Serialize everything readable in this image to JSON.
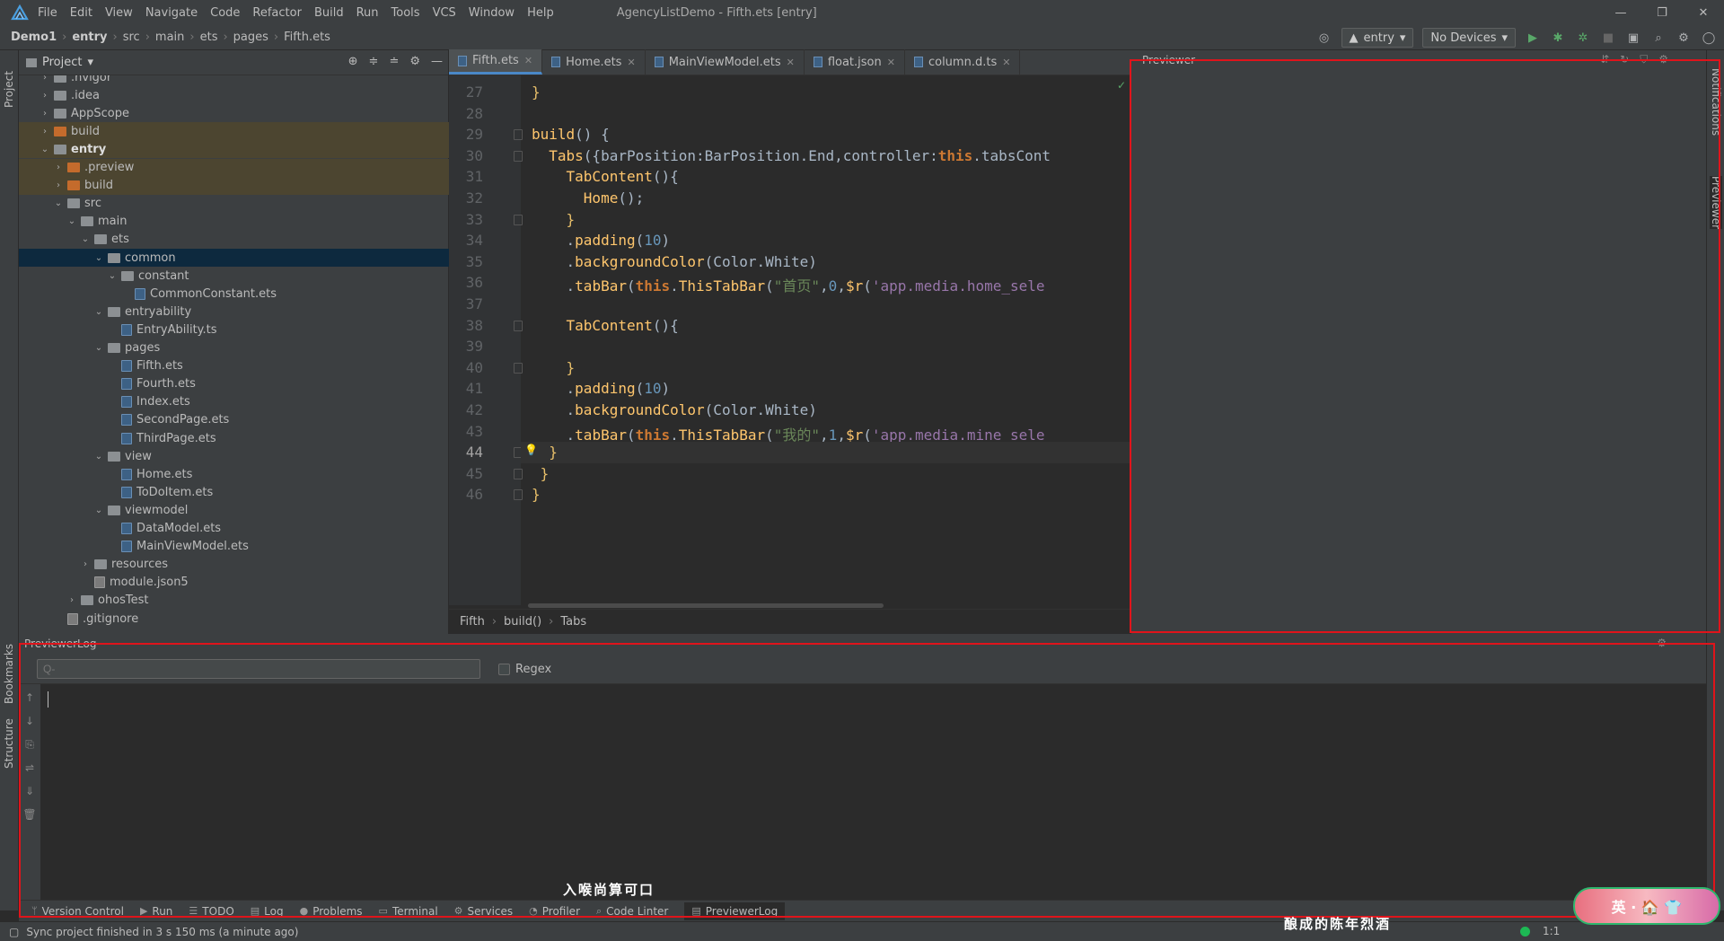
{
  "titlebar": {
    "menu": [
      "File",
      "Edit",
      "View",
      "Navigate",
      "Code",
      "Refactor",
      "Build",
      "Run",
      "Tools",
      "VCS",
      "Window",
      "Help"
    ],
    "window_title": "AgencyListDemo - Fifth.ets [entry]",
    "controls": [
      "—",
      "❐",
      "✕"
    ]
  },
  "breadcrumb": {
    "items": [
      "Demo1",
      "entry",
      "src",
      "main",
      "ets",
      "pages",
      "Fifth.ets"
    ]
  },
  "toolbar": {
    "module": "entry",
    "device": "No Devices"
  },
  "sidebar": {
    "project_label": "Project",
    "bookmarks_label": "Bookmarks",
    "structure_label": "Structure"
  },
  "rightbar": {
    "notifications_label": "Notifications",
    "previewer_label": "Previewer"
  },
  "project": {
    "title": "Project",
    "tree": [
      {
        "label": ".hvigor",
        "depth": 1,
        "kind": "folder",
        "open": false
      },
      {
        "label": ".idea",
        "depth": 1,
        "kind": "folder",
        "open": false
      },
      {
        "label": "AppScope",
        "depth": 1,
        "kind": "folder",
        "open": false
      },
      {
        "label": "build",
        "depth": 1,
        "kind": "folder-orange",
        "open": false,
        "hl": true
      },
      {
        "label": "entry",
        "depth": 1,
        "kind": "folder",
        "open": true,
        "bold": true,
        "hl": true
      },
      {
        "label": ".preview",
        "depth": 2,
        "kind": "folder-orange",
        "open": false,
        "hl": true
      },
      {
        "label": "build",
        "depth": 2,
        "kind": "folder-orange",
        "open": false,
        "hl": true
      },
      {
        "label": "src",
        "depth": 2,
        "kind": "folder",
        "open": true
      },
      {
        "label": "main",
        "depth": 3,
        "kind": "folder",
        "open": true
      },
      {
        "label": "ets",
        "depth": 4,
        "kind": "folder",
        "open": true
      },
      {
        "label": "common",
        "depth": 5,
        "kind": "folder",
        "open": true,
        "sel": true
      },
      {
        "label": "constant",
        "depth": 6,
        "kind": "folder",
        "open": true
      },
      {
        "label": "CommonConstant.ets",
        "depth": 7,
        "kind": "file"
      },
      {
        "label": "entryability",
        "depth": 5,
        "kind": "folder",
        "open": true
      },
      {
        "label": "EntryAbility.ts",
        "depth": 6,
        "kind": "file"
      },
      {
        "label": "pages",
        "depth": 5,
        "kind": "folder",
        "open": true
      },
      {
        "label": "Fifth.ets",
        "depth": 6,
        "kind": "file"
      },
      {
        "label": "Fourth.ets",
        "depth": 6,
        "kind": "file"
      },
      {
        "label": "Index.ets",
        "depth": 6,
        "kind": "file"
      },
      {
        "label": "SecondPage.ets",
        "depth": 6,
        "kind": "file"
      },
      {
        "label": "ThirdPage.ets",
        "depth": 6,
        "kind": "file"
      },
      {
        "label": "view",
        "depth": 5,
        "kind": "folder",
        "open": true
      },
      {
        "label": "Home.ets",
        "depth": 6,
        "kind": "file"
      },
      {
        "label": "ToDoItem.ets",
        "depth": 6,
        "kind": "file"
      },
      {
        "label": "viewmodel",
        "depth": 5,
        "kind": "folder",
        "open": true
      },
      {
        "label": "DataModel.ets",
        "depth": 6,
        "kind": "file"
      },
      {
        "label": "MainViewModel.ets",
        "depth": 6,
        "kind": "file"
      },
      {
        "label": "resources",
        "depth": 4,
        "kind": "folder",
        "open": false
      },
      {
        "label": "module.json5",
        "depth": 4,
        "kind": "file-json"
      },
      {
        "label": "ohosTest",
        "depth": 3,
        "kind": "folder",
        "open": false
      },
      {
        "label": ".gitignore",
        "depth": 2,
        "kind": "file-json"
      }
    ]
  },
  "editor": {
    "tabs": [
      {
        "label": "Fifth.ets",
        "active": true
      },
      {
        "label": "Home.ets",
        "active": false
      },
      {
        "label": "MainViewModel.ets",
        "active": false
      },
      {
        "label": "float.json",
        "active": false
      },
      {
        "label": "column.d.ts",
        "active": false
      }
    ],
    "current_line": 44,
    "lines": [
      {
        "n": "27",
        "html": "<span class='tag'>}</span>"
      },
      {
        "n": "28",
        "html": ""
      },
      {
        "n": "29",
        "html": "<span class='fn'>build</span><span class='tx'>() {</span>"
      },
      {
        "n": "30",
        "html": "  <span class='fn'>Tabs</span><span class='tx'>({barPosition:BarPosition.End,controller:</span><span class='this'>this</span><span class='tx'>.tabsCont</span>"
      },
      {
        "n": "31",
        "html": "    <span class='fn'>TabContent</span><span class='tx'>(){</span>"
      },
      {
        "n": "32",
        "html": "      <span class='fn'>Home</span><span class='tx'>();</span>"
      },
      {
        "n": "33",
        "html": "    <span class='tag'>}</span>"
      },
      {
        "n": "34",
        "html": "    <span class='tx'>.</span><span class='fn'>padding</span><span class='tx'>(</span><span class='num'>10</span><span class='tx'>)</span>"
      },
      {
        "n": "35",
        "html": "    <span class='tx'>.</span><span class='fn'>backgroundColor</span><span class='tx'>(Color.White)</span>"
      },
      {
        "n": "36",
        "html": "    <span class='tx'>.</span><span class='fn'>tabBar</span><span class='tx'>(</span><span class='this'>this</span><span class='tx'>.</span><span class='fn'>ThisTabBar</span><span class='tx'>(</span><span class='str'>\"首页\"</span><span class='tx'>,</span><span class='num'>0</span><span class='tx'>,</span><span class='fn'>$r</span><span class='tx'>(</span><span class='pur'>'app.media.home_sele</span>"
      },
      {
        "n": "37",
        "html": ""
      },
      {
        "n": "38",
        "html": "    <span class='fn'>TabContent</span><span class='tx'>(){</span>"
      },
      {
        "n": "39",
        "html": ""
      },
      {
        "n": "40",
        "html": "    <span class='tag'>}</span>"
      },
      {
        "n": "41",
        "html": "    <span class='tx'>.</span><span class='fn'>padding</span><span class='tx'>(</span><span class='num'>10</span><span class='tx'>)</span>"
      },
      {
        "n": "42",
        "html": "    <span class='tx'>.</span><span class='fn'>backgroundColor</span><span class='tx'>(Color.White)</span>"
      },
      {
        "n": "43",
        "html": "    <span class='tx'>.</span><span class='fn'>tabBar</span><span class='tx'>(</span><span class='this'>this</span><span class='tx'>.</span><span class='fn'>ThisTabBar</span><span class='tx'>(</span><span class='str'>\"我的\"</span><span class='tx'>,</span><span class='num'>1</span><span class='tx'>,</span><span class='fn'>$r</span><span class='tx'>(</span><span class='pur'>'app.media.mine_sele</span>"
      },
      {
        "n": "44",
        "html": "  <span class='tag'>}</span>"
      },
      {
        "n": "45",
        "html": " <span class='tag'>}</span>"
      },
      {
        "n": "46",
        "html": "<span class='tag'>}</span>"
      }
    ],
    "footer_crumbs": [
      "Fifth",
      "build()",
      "Tabs"
    ]
  },
  "previewer": {
    "title": "Previewer"
  },
  "log": {
    "title": "PreviewerLog",
    "search_placeholder": "Q-",
    "regex_label": "Regex"
  },
  "bottom_tabs": [
    "Version Control",
    "Run",
    "TODO",
    "Log",
    "Problems",
    "Terminal",
    "Services",
    "Profiler",
    "Code Linter",
    "PreviewerLog"
  ],
  "status": {
    "message": "Sync project finished in 3 s 150 ms (a minute ago)",
    "ratio": "1:1"
  },
  "overlay": {
    "top_text": "入喉尚算可口",
    "bottom_text": "酿成的陈年烈酒",
    "badge_text": "英 · 🏠 👕"
  },
  "colors": {
    "accent_red": "#e0141b",
    "selection": "#0d293e"
  }
}
